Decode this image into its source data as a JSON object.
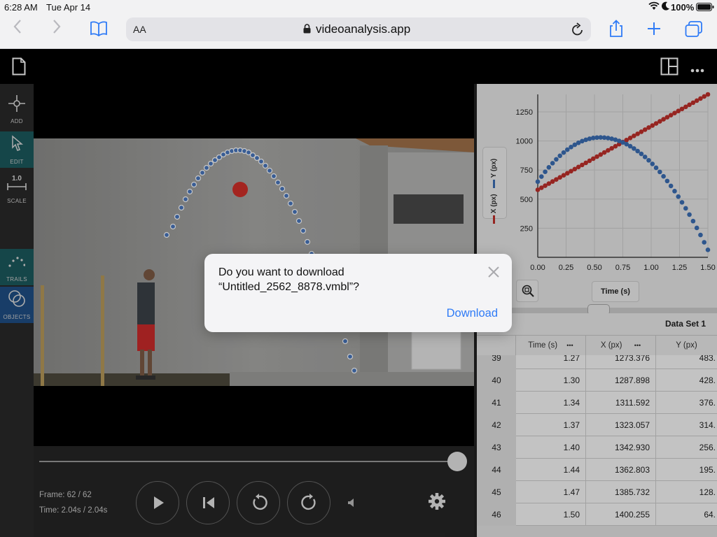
{
  "status": {
    "time": "6:28 AM",
    "date": "Tue Apr 14",
    "battery": "100%"
  },
  "browser": {
    "text_size": "AA",
    "url": "videoanalysis.app"
  },
  "toolbar": {
    "add_label": "ADD",
    "edit_label": "EDIT",
    "scale_value": "1.0",
    "scale_label": "SCALE",
    "trails_label": "TRAILS",
    "objects_label": "OBJECTS"
  },
  "playback": {
    "frame_text": "Frame: 62 / 62",
    "time_text": "Time: 2.04s / 2.04s",
    "progress": 1.0
  },
  "graph": {
    "legend_y": "Y (px)",
    "legend_x": "X (px)",
    "x_axis_button": "Time (s)",
    "colors": {
      "x": "#c0302b",
      "y": "#3b6fb5"
    }
  },
  "chart_data": {
    "type": "scatter",
    "xlabel": "Time (s)",
    "xlim": [
      0,
      1.5
    ],
    "ylim": [
      0,
      1400
    ],
    "x_ticks": [
      "0.00",
      "0.25",
      "0.50",
      "0.75",
      "1.00",
      "1.25",
      "1.50"
    ],
    "y_ticks": [
      "250",
      "500",
      "750",
      "1000",
      "1250"
    ],
    "series": [
      {
        "name": "X (px)",
        "color": "#c0302b",
        "start": [
          0,
          580
        ],
        "end": [
          1.5,
          1400
        ]
      },
      {
        "name": "Y (px)",
        "color": "#3b6fb5",
        "vertex": [
          0.55,
          1030
        ],
        "start": [
          0,
          650
        ],
        "end": [
          1.5,
          64
        ]
      }
    ]
  },
  "table": {
    "title": "Data Set 1",
    "columns": [
      "Time (s)",
      "X (px)",
      "Y (px)"
    ],
    "more_icon": "•••",
    "rows": [
      [
        "39",
        "1.27",
        "1273.376",
        "483."
      ],
      [
        "40",
        "1.30",
        "1287.898",
        "428."
      ],
      [
        "41",
        "1.34",
        "1311.592",
        "376."
      ],
      [
        "42",
        "1.37",
        "1323.057",
        "314."
      ],
      [
        "43",
        "1.40",
        "1342.930",
        "256."
      ],
      [
        "44",
        "1.44",
        "1362.803",
        "195."
      ],
      [
        "45",
        "1.47",
        "1385.732",
        "128."
      ],
      [
        "46",
        "1.50",
        "1400.255",
        "64."
      ]
    ]
  },
  "dialog": {
    "line1": "Do you want to download",
    "line2": "“Untitled_2562_8878.vmbl”?",
    "action": "Download"
  }
}
